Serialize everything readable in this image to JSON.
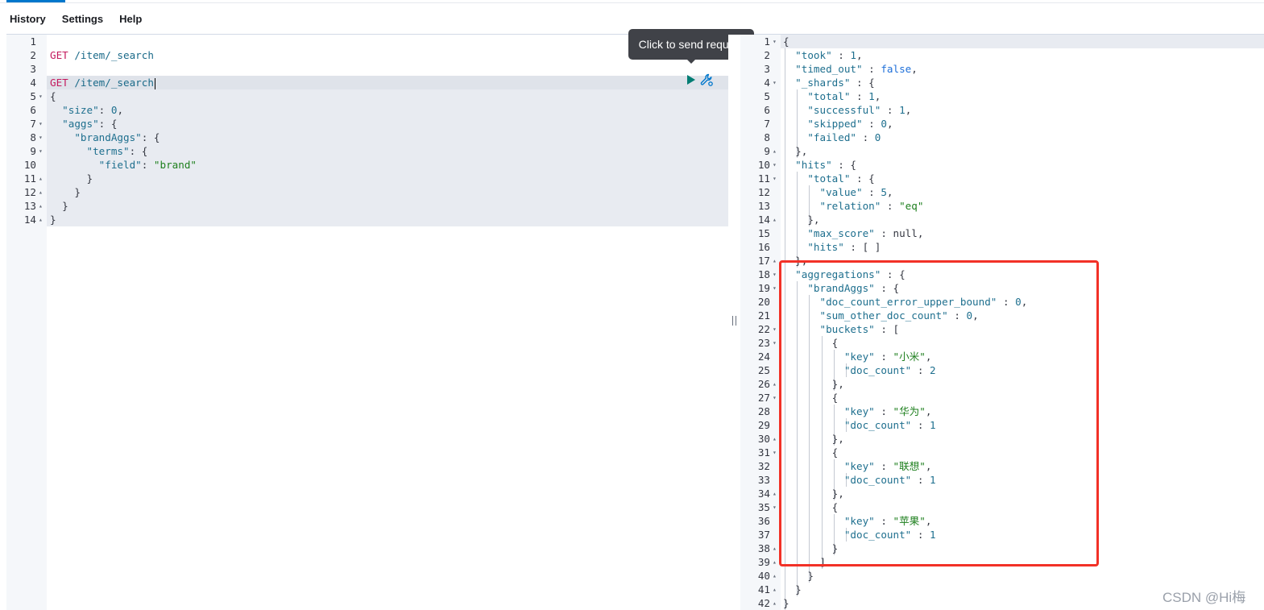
{
  "menu": {
    "history": "History",
    "settings": "Settings",
    "help": "Help"
  },
  "tooltip": {
    "text": "Click to send request"
  },
  "request_lines": [
    {
      "n": "1",
      "fold": "",
      "html": ""
    },
    {
      "n": "2",
      "fold": "",
      "html": "<span class='k-method'>GET</span> <span class='k-url'>/item/_search</span>"
    },
    {
      "n": "3",
      "fold": "",
      "html": ""
    },
    {
      "n": "4",
      "fold": "",
      "html": "<span class='k-method'>GET</span> <span class='k-url'>/item/_search</span><span class='cursor'></span>"
    },
    {
      "n": "5",
      "fold": "▾",
      "html": "<span class='k-punc'>{</span>"
    },
    {
      "n": "6",
      "fold": "",
      "html": "  <span class='k-key'>\"size\"</span><span class='k-punc'>: </span><span class='k-num'>0</span><span class='k-punc'>,</span>"
    },
    {
      "n": "7",
      "fold": "▾",
      "html": "  <span class='k-key'>\"aggs\"</span><span class='k-punc'>: {</span>"
    },
    {
      "n": "8",
      "fold": "▾",
      "html": "    <span class='k-key'>\"brandAggs\"</span><span class='k-punc'>: {</span>"
    },
    {
      "n": "9",
      "fold": "▾",
      "html": "      <span class='k-key'>\"terms\"</span><span class='k-punc'>: {</span>"
    },
    {
      "n": "10",
      "fold": "",
      "html": "        <span class='k-key'>\"field\"</span><span class='k-punc'>: </span><span class='k-str'>\"brand\"</span>"
    },
    {
      "n": "11",
      "fold": "▴",
      "html": "      <span class='k-punc'>}</span>"
    },
    {
      "n": "12",
      "fold": "▴",
      "html": "    <span class='k-punc'>}</span>"
    },
    {
      "n": "13",
      "fold": "▴",
      "html": "  <span class='k-punc'>}</span>"
    },
    {
      "n": "14",
      "fold": "▴",
      "html": "<span class='k-punc'>}</span>"
    }
  ],
  "response_lines": [
    {
      "n": "1",
      "fold": "▾",
      "html": "<span class='k-punc'>{</span>"
    },
    {
      "n": "2",
      "fold": "",
      "html": "  <span class='k-key'>\"took\"</span><span class='k-punc'> : </span><span class='k-num'>1</span><span class='k-punc'>,</span>"
    },
    {
      "n": "3",
      "fold": "",
      "html": "  <span class='k-key'>\"timed_out\"</span><span class='k-punc'> : </span><span class='k-bool'>false</span><span class='k-punc'>,</span>"
    },
    {
      "n": "4",
      "fold": "▾",
      "html": "  <span class='k-key'>\"_shards\"</span><span class='k-punc'> : {</span>"
    },
    {
      "n": "5",
      "fold": "",
      "html": "    <span class='k-key'>\"total\"</span><span class='k-punc'> : </span><span class='k-num'>1</span><span class='k-punc'>,</span>"
    },
    {
      "n": "6",
      "fold": "",
      "html": "    <span class='k-key'>\"successful\"</span><span class='k-punc'> : </span><span class='k-num'>1</span><span class='k-punc'>,</span>"
    },
    {
      "n": "7",
      "fold": "",
      "html": "    <span class='k-key'>\"skipped\"</span><span class='k-punc'> : </span><span class='k-num'>0</span><span class='k-punc'>,</span>"
    },
    {
      "n": "8",
      "fold": "",
      "html": "    <span class='k-key'>\"failed\"</span><span class='k-punc'> : </span><span class='k-num'>0</span>"
    },
    {
      "n": "9",
      "fold": "▴",
      "html": "  <span class='k-punc'>},</span>"
    },
    {
      "n": "10",
      "fold": "▾",
      "html": "  <span class='k-key'>\"hits\"</span><span class='k-punc'> : {</span>"
    },
    {
      "n": "11",
      "fold": "▾",
      "html": "    <span class='k-key'>\"total\"</span><span class='k-punc'> : {</span>"
    },
    {
      "n": "12",
      "fold": "",
      "html": "      <span class='k-key'>\"value\"</span><span class='k-punc'> : </span><span class='k-num'>5</span><span class='k-punc'>,</span>"
    },
    {
      "n": "13",
      "fold": "",
      "html": "      <span class='k-key'>\"relation\"</span><span class='k-punc'> : </span><span class='k-str'>\"eq\"</span>"
    },
    {
      "n": "14",
      "fold": "▴",
      "html": "    <span class='k-punc'>},</span>"
    },
    {
      "n": "15",
      "fold": "",
      "html": "    <span class='k-key'>\"max_score\"</span><span class='k-punc'> : </span><span class='k-null'>null</span><span class='k-punc'>,</span>"
    },
    {
      "n": "16",
      "fold": "",
      "html": "    <span class='k-key'>\"hits\"</span><span class='k-punc'> : [ ]</span>"
    },
    {
      "n": "17",
      "fold": "▴",
      "html": "  <span class='k-punc'>},</span>"
    },
    {
      "n": "18",
      "fold": "▾",
      "html": "  <span class='k-key'>\"aggregations\"</span><span class='k-punc'> : {</span>"
    },
    {
      "n": "19",
      "fold": "▾",
      "html": "    <span class='k-key'>\"brandAggs\"</span><span class='k-punc'> : {</span>"
    },
    {
      "n": "20",
      "fold": "",
      "html": "      <span class='k-key'>\"doc_count_error_upper_bound\"</span><span class='k-punc'> : </span><span class='k-num'>0</span><span class='k-punc'>,</span>"
    },
    {
      "n": "21",
      "fold": "",
      "html": "      <span class='k-key'>\"sum_other_doc_count\"</span><span class='k-punc'> : </span><span class='k-num'>0</span><span class='k-punc'>,</span>"
    },
    {
      "n": "22",
      "fold": "▾",
      "html": "      <span class='k-key'>\"buckets\"</span><span class='k-punc'> : [</span>"
    },
    {
      "n": "23",
      "fold": "▾",
      "html": "        <span class='k-punc'>{</span>"
    },
    {
      "n": "24",
      "fold": "",
      "html": "          <span class='k-key'>\"key\"</span><span class='k-punc'> : </span><span class='k-str'>\"小米\"</span><span class='k-punc'>,</span>"
    },
    {
      "n": "25",
      "fold": "",
      "html": "          <span class='k-key'>\"doc_count\"</span><span class='k-punc'> : </span><span class='k-num'>2</span>"
    },
    {
      "n": "26",
      "fold": "▴",
      "html": "        <span class='k-punc'>},</span>"
    },
    {
      "n": "27",
      "fold": "▾",
      "html": "        <span class='k-punc'>{</span>"
    },
    {
      "n": "28",
      "fold": "",
      "html": "          <span class='k-key'>\"key\"</span><span class='k-punc'> : </span><span class='k-str'>\"华为\"</span><span class='k-punc'>,</span>"
    },
    {
      "n": "29",
      "fold": "",
      "html": "          <span class='k-key'>\"doc_count\"</span><span class='k-punc'> : </span><span class='k-num'>1</span>"
    },
    {
      "n": "30",
      "fold": "▴",
      "html": "        <span class='k-punc'>},</span>"
    },
    {
      "n": "31",
      "fold": "▾",
      "html": "        <span class='k-punc'>{</span>"
    },
    {
      "n": "32",
      "fold": "",
      "html": "          <span class='k-key'>\"key\"</span><span class='k-punc'> : </span><span class='k-str'>\"联想\"</span><span class='k-punc'>,</span>"
    },
    {
      "n": "33",
      "fold": "",
      "html": "          <span class='k-key'>\"doc_count\"</span><span class='k-punc'> : </span><span class='k-num'>1</span>"
    },
    {
      "n": "34",
      "fold": "▴",
      "html": "        <span class='k-punc'>},</span>"
    },
    {
      "n": "35",
      "fold": "▾",
      "html": "        <span class='k-punc'>{</span>"
    },
    {
      "n": "36",
      "fold": "",
      "html": "          <span class='k-key'>\"key\"</span><span class='k-punc'> : </span><span class='k-str'>\"苹果\"</span><span class='k-punc'>,</span>"
    },
    {
      "n": "37",
      "fold": "",
      "html": "          <span class='k-key'>\"doc_count\"</span><span class='k-punc'> : </span><span class='k-num'>1</span>"
    },
    {
      "n": "38",
      "fold": "▴",
      "html": "        <span class='k-punc'>}</span>"
    },
    {
      "n": "39",
      "fold": "▴",
      "html": "      <span class='k-punc'>]</span>"
    },
    {
      "n": "40",
      "fold": "▴",
      "html": "    <span class='k-punc'>}</span>"
    },
    {
      "n": "41",
      "fold": "▴",
      "html": "  <span class='k-punc'>}</span>"
    },
    {
      "n": "42",
      "fold": "▴",
      "html": "<span class='k-punc'>}</span>"
    }
  ],
  "watermark": "CSDN @Hi梅",
  "colors": {
    "accent": "#0077cc",
    "highlight_box": "#f23127",
    "play": "#017d73",
    "wrench": "#0077cc"
  }
}
